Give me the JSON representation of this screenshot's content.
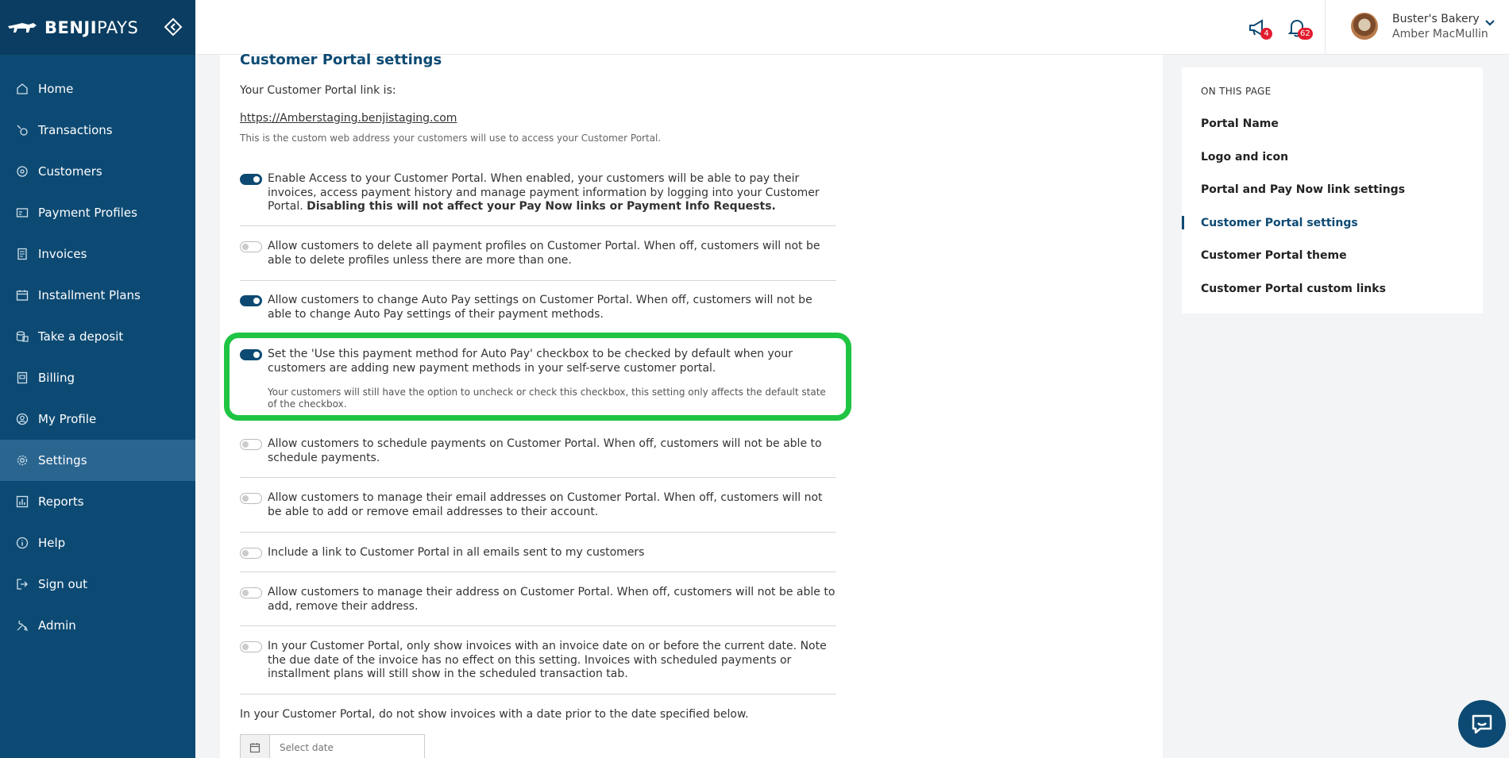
{
  "brand": {
    "name_bold": "BENJI",
    "name_light": "PAYS"
  },
  "sidebar": {
    "items": [
      {
        "label": "Home",
        "icon": "home-icon"
      },
      {
        "label": "Transactions",
        "icon": "transactions-icon"
      },
      {
        "label": "Customers",
        "icon": "customers-icon"
      },
      {
        "label": "Payment Profiles",
        "icon": "payment-profiles-icon"
      },
      {
        "label": "Invoices",
        "icon": "invoices-icon"
      },
      {
        "label": "Installment Plans",
        "icon": "calendar-icon"
      },
      {
        "label": "Take a deposit",
        "icon": "deposit-icon"
      },
      {
        "label": "Billing",
        "icon": "billing-icon"
      },
      {
        "label": "My Profile",
        "icon": "user-icon"
      },
      {
        "label": "Settings",
        "icon": "gear-icon",
        "active": true
      },
      {
        "label": "Reports",
        "icon": "reports-icon"
      },
      {
        "label": "Help",
        "icon": "help-icon"
      },
      {
        "label": "Sign out",
        "icon": "sign-out-icon"
      },
      {
        "label": "Admin",
        "icon": "admin-icon"
      }
    ]
  },
  "topbar": {
    "announcements_count": "4",
    "notifications_count": "62",
    "account_name": "Buster's Bakery",
    "user_name": "Amber MacMullin"
  },
  "main": {
    "title": "Customer Portal settings",
    "portal_label": "Your Customer Portal link is:",
    "portal_link": "https://Amberstaging.benjistaging.com",
    "portal_help": "This is the custom web address your customers will use to access your Customer Portal.",
    "settings": [
      {
        "on": true,
        "text": "Enable Access to your Customer Portal. When enabled, your customers will be able to pay their invoices, access payment history and manage payment information by logging into your Customer Portal.",
        "bold": "Disabling this will not affect your Pay Now links or Payment Info Requests."
      },
      {
        "on": false,
        "text": "Allow customers to delete all payment profiles on Customer Portal. When off, customers will not be able to delete profiles unless there are more than one."
      },
      {
        "on": true,
        "text": "Allow customers to change Auto Pay settings on Customer Portal. When off, customers will not be able to change Auto Pay settings of their payment methods."
      },
      {
        "on": true,
        "text": "Set the 'Use this payment method for Auto Pay' checkbox to be checked by default when your customers are adding new payment methods in your self-serve customer portal.",
        "sub": "Your customers will still have the option to uncheck or check this checkbox, this setting only affects the default state of the checkbox."
      },
      {
        "on": false,
        "text": "Allow customers to schedule payments on Customer Portal. When off, customers will not be able to schedule payments."
      },
      {
        "on": false,
        "text": "Allow customers to manage their email addresses on Customer Portal. When off, customers will not be able to add or remove email addresses to their account."
      },
      {
        "on": false,
        "text": "Include a link to Customer Portal in all emails sent to my customers"
      },
      {
        "on": false,
        "text": "Allow customers to manage their address on Customer Portal. When off, customers will not be able to add, remove their address."
      },
      {
        "on": false,
        "text": "In your Customer Portal, only show invoices with an invoice date on or before the current date. Note the due date of the invoice has no effect on this setting. Invoices with scheduled payments or installment plans will still show in the scheduled transaction tab."
      }
    ],
    "date_label": "In your Customer Portal, do not show invoices with a date prior to the date specified below.",
    "date_placeholder": "Select date"
  },
  "toc": {
    "header": "ON THIS PAGE",
    "items": [
      {
        "label": "Portal Name"
      },
      {
        "label": "Logo and icon"
      },
      {
        "label": "Portal and Pay Now link settings"
      },
      {
        "label": "Customer Portal settings",
        "active": true
      },
      {
        "label": "Customer Portal theme"
      },
      {
        "label": "Customer Portal custom links"
      }
    ]
  },
  "colors": {
    "sidebar": "#0d4a73",
    "accent": "#0d4a73",
    "highlight": "#1fc443",
    "badge": "#e11d2e"
  }
}
